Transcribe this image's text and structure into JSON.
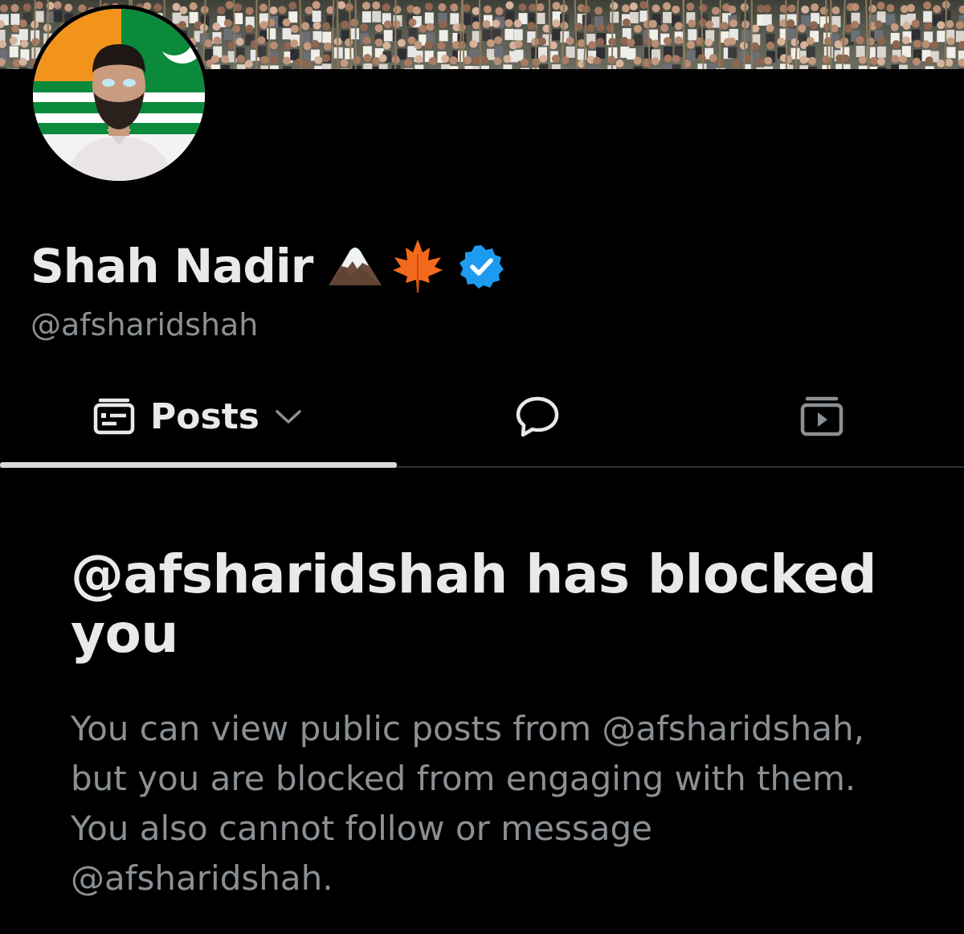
{
  "profile": {
    "display_name": "Shah Nadir",
    "name_emojis": [
      "mountain-icon",
      "maple-leaf-icon"
    ],
    "verified": true,
    "handle": "@afsharidshah"
  },
  "tabs": [
    {
      "label": "Posts",
      "icon": "posts-icon",
      "has_dropdown": true,
      "selected": true
    },
    {
      "label": "",
      "icon": "replies-icon",
      "selected": false
    },
    {
      "label": "",
      "icon": "media-icon",
      "selected": false
    }
  ],
  "blocked": {
    "title": "@afsharidshah has blocked you",
    "message": "You can view public posts from @afsharidshah, but you are blocked from engaging with them. You also cannot follow or message @afsharidshah."
  },
  "colors": {
    "background": "#000000",
    "text_primary": "#e7e9ea",
    "text_secondary": "#8b9094",
    "verified_blue": "#1d9bf0"
  }
}
